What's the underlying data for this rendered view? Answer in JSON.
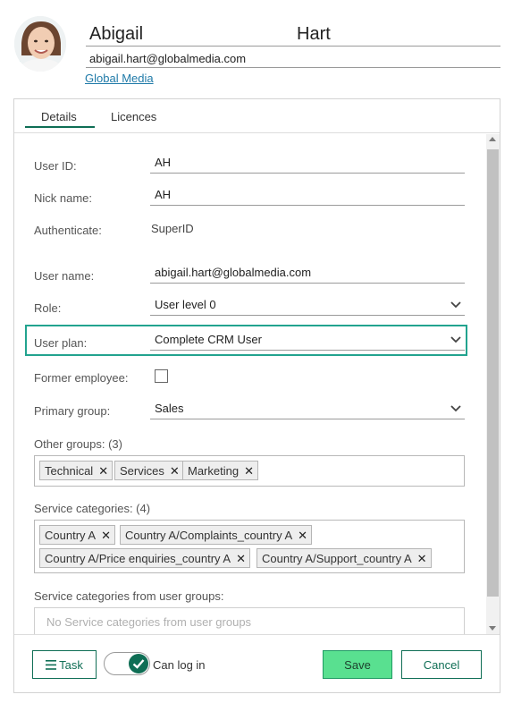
{
  "user": {
    "first_name": "Abigail",
    "last_name": "Hart",
    "email": "abigail.hart@globalmedia.com",
    "company": "Global Media"
  },
  "tabs": [
    {
      "label": "Details",
      "active": true
    },
    {
      "label": "Licences",
      "active": false
    }
  ],
  "details": {
    "user_id_label": "User ID:",
    "user_id_value": "AH",
    "nick_name_label": "Nick name:",
    "nick_name_value": "AH",
    "authenticate_label": "Authenticate:",
    "authenticate_value": "SuperID",
    "user_name_label": "User name:",
    "user_name_value": "abigail.hart@globalmedia.com",
    "role_label": "Role:",
    "role_value": "User level 0",
    "user_plan_label": "User plan:",
    "user_plan_value": "Complete CRM User",
    "former_employee_label": "Former employee:",
    "former_employee_checked": false,
    "primary_group_label": "Primary group:",
    "primary_group_value": "Sales",
    "other_groups_label": "Other groups: (3)",
    "other_groups": [
      "Technical",
      "Services",
      "Marketing"
    ],
    "service_categories_label": "Service categories: (4)",
    "service_categories": [
      "Country A",
      "Country A/Complaints_country A",
      "Country A/Price enquiries_country A",
      "Country A/Support_country A"
    ],
    "service_categories_from_groups_label": "Service categories from user groups:",
    "service_categories_from_groups_placeholder": "No Service categories from user groups"
  },
  "footer": {
    "task_label": "Task",
    "can_log_in_label": "Can log in",
    "can_log_in": true,
    "save_label": "Save",
    "cancel_label": "Cancel"
  },
  "colors": {
    "accent": "#0f6e55",
    "highlight_border": "#22a38f",
    "save_button": "#59e090",
    "link": "#1f7aa8"
  },
  "icons": [
    "avatar-photo",
    "chevron-down-icon",
    "remove-tag-icon",
    "menu-lines-icon",
    "checkmark-icon"
  ]
}
